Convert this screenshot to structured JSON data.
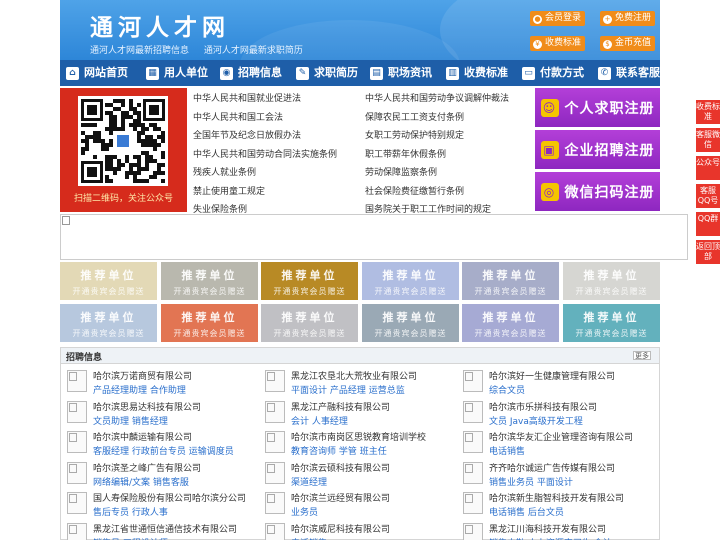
{
  "header": {
    "title": "通河人才网",
    "subtitles": [
      "通河人才网最新招聘信息",
      "通河人才网最新求职简历"
    ],
    "buttons": {
      "login": "会员登录",
      "register": "免费注册",
      "fees": "收费标准",
      "recharge": "金币充值"
    }
  },
  "nav": [
    {
      "label": "网站首页",
      "icon": "home-icon",
      "glyph": "⌂"
    },
    {
      "label": "用人单位",
      "icon": "building-icon",
      "glyph": "▦"
    },
    {
      "label": "招聘信息",
      "icon": "megaphone-icon",
      "glyph": "◉"
    },
    {
      "label": "求职简历",
      "icon": "resume-icon",
      "glyph": "✎"
    },
    {
      "label": "职场资讯",
      "icon": "news-icon",
      "glyph": "▤"
    },
    {
      "label": "收费标准",
      "icon": "chart-icon",
      "glyph": "▥"
    },
    {
      "label": "付款方式",
      "icon": "payment-icon",
      "glyph": "▭"
    },
    {
      "label": "联系客服",
      "icon": "phone-icon",
      "glyph": "✆"
    }
  ],
  "qr": {
    "caption": "扫描二维码，关注公众号"
  },
  "laws": [
    "中华人民共和国就业促进法",
    "中华人民共和国劳动争议调解仲裁法",
    "中华人民共和国工会法",
    "保障农民工工资支付条例",
    "全国年节及纪念日放假办法",
    "女职工劳动保护特别规定",
    "中华人民共和国劳动合同法实施条例",
    "职工带薪年休假条例",
    "残疾人就业条例",
    "劳动保障监察条例",
    "禁止使用童工规定",
    "社会保险费征缴暂行条例",
    "失业保险条例",
    "国务院关于职工工作时间的规定"
  ],
  "register": [
    {
      "label": "个人求职注册",
      "icon": "person-icon",
      "glyph": "☺"
    },
    {
      "label": "企业招聘注册",
      "icon": "company-icon",
      "glyph": "▣"
    },
    {
      "label": "微信扫码注册",
      "icon": "wechat-icon",
      "glyph": "◎"
    }
  ],
  "side_float": [
    {
      "label": "收费标准"
    },
    {
      "label": "客服微信"
    },
    {
      "label": "公众号"
    },
    {
      "label": "客服QQ号"
    },
    {
      "label": "QQ群"
    },
    {
      "label": "返回顶部"
    }
  ],
  "recommend": {
    "title": "推荐单位",
    "sub": "开通贵宾会员赠送",
    "row1_colors": [
      "#e3d9b6",
      "#b9b8ae",
      "#b88a25",
      "#b0bde2",
      "#a7adc9",
      "#d6d6d2"
    ],
    "row2_colors": [
      "#b7c8de",
      "#e27553",
      "#c0c0c4",
      "#9aa9b5",
      "#a6aad4",
      "#63b1bd"
    ]
  },
  "jobs": {
    "title": "招聘信息",
    "more": "更多",
    "items": [
      {
        "company": "哈尔滨万诺商贸有限公司",
        "positions": "产品经理助理 合作助理"
      },
      {
        "company": "黑龙江农垦北大荒牧业有限公司",
        "positions": "平面设计 产品经理 运营总监"
      },
      {
        "company": "哈尔滨好一生健康管理有限公司",
        "positions": "综合文员"
      },
      {
        "company": "哈尔滨思易达科技有限公司",
        "positions": "文员助理 销售经理"
      },
      {
        "company": "黑龙江产融科技有限公司",
        "positions": "会计 人事经理"
      },
      {
        "company": "哈尔滨市乐拼科技有限公司",
        "positions": "文员 Java高级开发工程"
      },
      {
        "company": "哈尔滨中麟运输有限公司",
        "positions": "客服经理 行政前台专员 运输调度员"
      },
      {
        "company": "哈尔滨市南岗区思锐教育培训学校",
        "positions": "教育咨询师 学管 班主任"
      },
      {
        "company": "哈尔滨华友汇企业管理咨询有限公司",
        "positions": "电话销售"
      },
      {
        "company": "哈尔滨圣之峰广告有限公司",
        "positions": "网络编辑/文案 销售客服"
      },
      {
        "company": "哈尔滨云硕科技有限公司",
        "positions": "渠道经理"
      },
      {
        "company": "齐齐哈尔诚运广告传媒有限公司",
        "positions": "销售业务员 平面设计"
      },
      {
        "company": "国人寿保险股份有限公司哈尔滨分公司",
        "positions": "售后专员 行政人事"
      },
      {
        "company": "哈尔滨兰远经贸有限公司",
        "positions": "业务员"
      },
      {
        "company": "哈尔滨新生脂智科技开发有限公司",
        "positions": "电话销售 后台文员"
      },
      {
        "company": "黑龙江省世通恒信通信技术有限公司",
        "positions": "销售员 工程设计师"
      },
      {
        "company": "哈尔滨威尼科技有限公司",
        "positions": "电话销售"
      },
      {
        "company": "黑龙江川海科技开发有限公司",
        "positions": "销售内勤 人力资源实习生 会计"
      }
    ]
  },
  "colors": {
    "header": "#2d86d8",
    "nav": "#1e5ea8",
    "accent": "#f08c1a",
    "purple": "#9b31c9",
    "red": "#e8352b"
  }
}
